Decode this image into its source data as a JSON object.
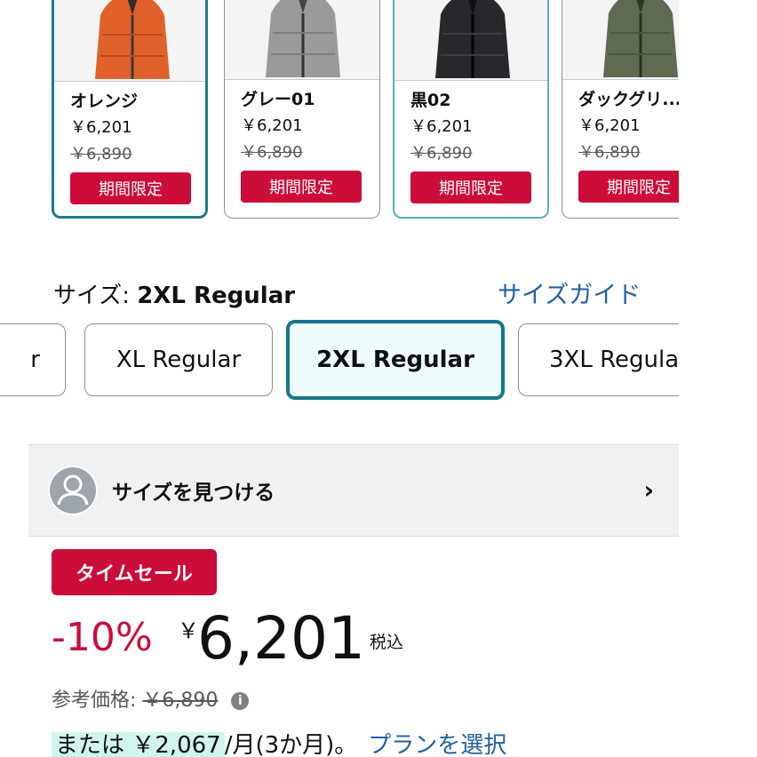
{
  "colors_accent": {
    "badge": "#cc0c39",
    "selected_border": "#13788a",
    "link": "#2162a1"
  },
  "swatches": [
    {
      "name": "オレンジ",
      "price": "￥6,201",
      "original": "￥6,890",
      "badge": "期間限定",
      "color": "#e0622a"
    },
    {
      "name": "グレー01",
      "price": "￥6,201",
      "original": "￥6,890",
      "badge": "期間限定",
      "color": "#9a9a9a"
    },
    {
      "name": "黒02",
      "price": "￥6,201",
      "original": "￥6,890",
      "badge": "期間限定",
      "color": "#26282c"
    },
    {
      "name": "ダックグリ...",
      "price": "￥6,201",
      "original": "￥6,890",
      "badge": "期間限定",
      "color": "#5e6a52"
    }
  ],
  "size": {
    "label": "サイズ:",
    "selected": "2XL Regular",
    "guide_link": "サイズガイド",
    "options": [
      "r",
      "XL Regular",
      "2XL Regular",
      "3XL Regula"
    ]
  },
  "find_size": {
    "label": "サイズを見つける",
    "chevron": "›"
  },
  "pricing": {
    "time_sale": "タイムセール",
    "discount": "-10%",
    "yen": "￥",
    "price": "6,201",
    "tax": "税込",
    "reference_label": "参考価格:",
    "reference_price": "￥6,890",
    "info_icon": "i",
    "installment_prefix": "または ￥2,067",
    "installment_suffix": "/月(3か月)。",
    "plan_link": "プランを選択"
  }
}
